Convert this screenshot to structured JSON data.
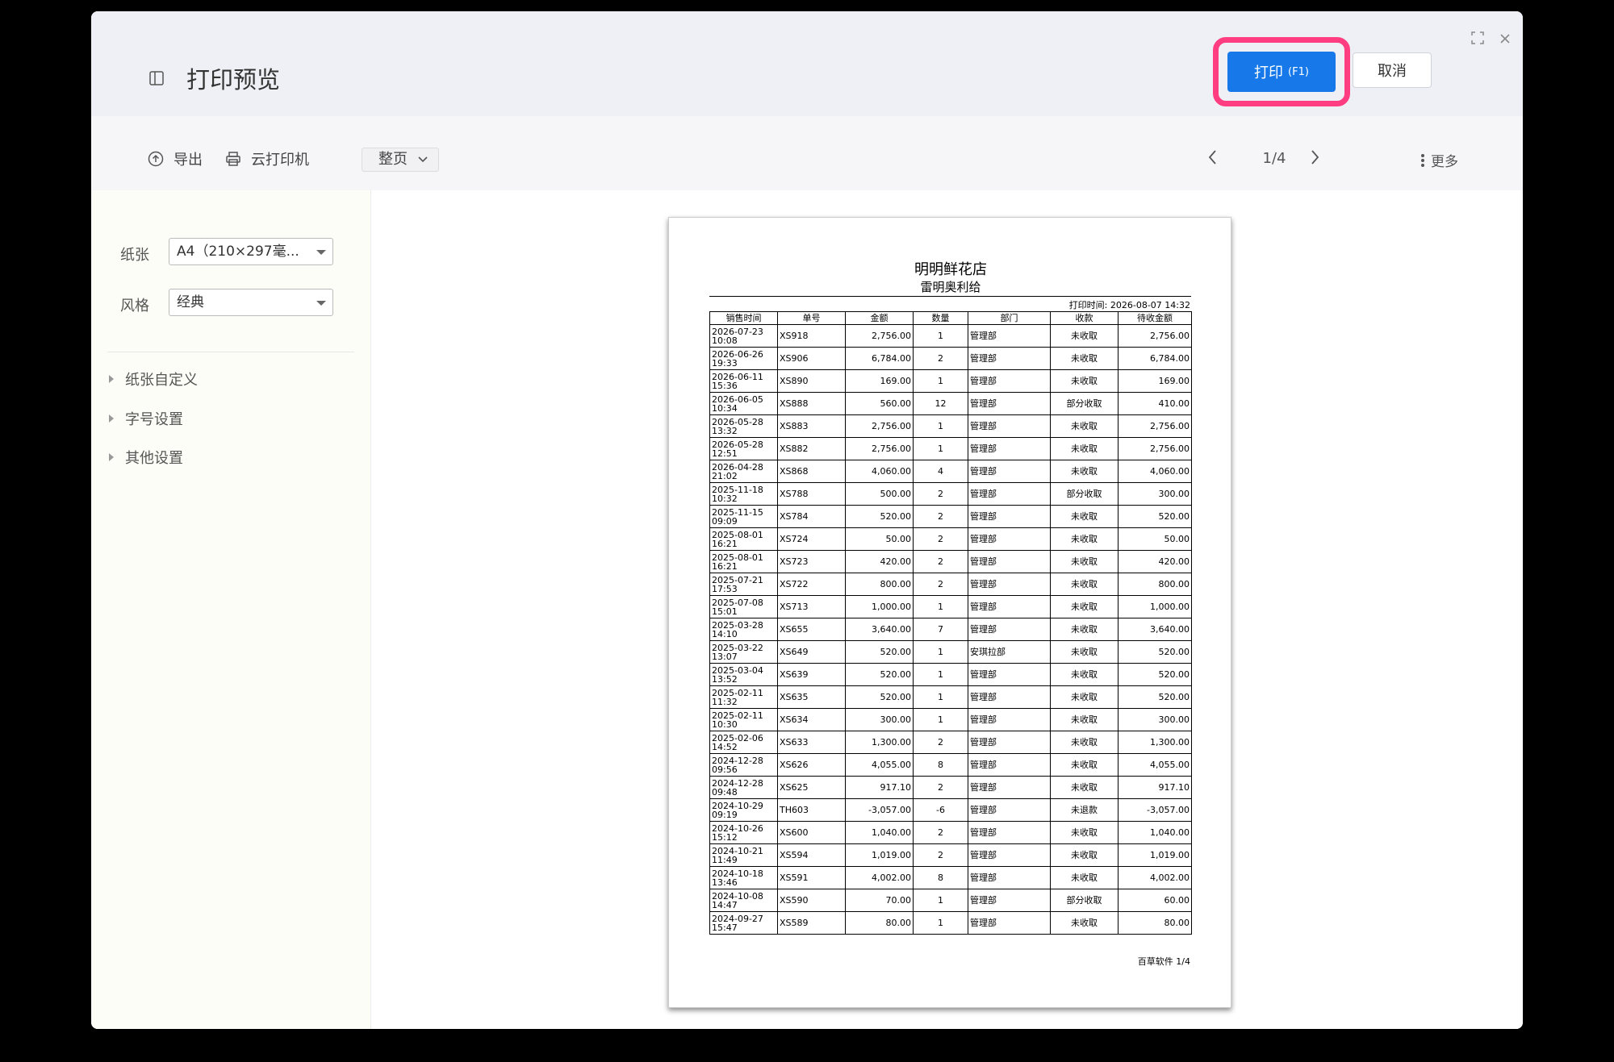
{
  "dialog": {
    "title": "打印预览",
    "print_label": "打印",
    "print_shortcut": "(F1)",
    "cancel_label": "取消",
    "colors": {
      "primary": "#1779e9",
      "highlight": "#ff3d80"
    }
  },
  "toolbar": {
    "export_label": "导出",
    "cloud_printer_label": "云打印机",
    "page_mode": "整页",
    "page_indicator": "1/4",
    "more_label": "更多"
  },
  "sidebar": {
    "paper_label": "纸张",
    "paper_value": "A4（210×297毫...",
    "style_label": "风格",
    "style_value": "经典",
    "sections": [
      "纸张自定义",
      "字号设置",
      "其他设置"
    ]
  },
  "document": {
    "title": "明明鲜花店",
    "subtitle": "雷明奥利给",
    "print_time": "打印时间:  2026-08-07 14:32",
    "footer": "百草软件  1/4",
    "columns": [
      "销售时间",
      "单号",
      "金额",
      "数量",
      "部门",
      "收款",
      "待收金额"
    ],
    "rows": [
      [
        "2026-07-23 10:08",
        "XS918",
        "2,756.00",
        "1",
        "管理部",
        "未收取",
        "2,756.00"
      ],
      [
        "2026-06-26 19:33",
        "XS906",
        "6,784.00",
        "2",
        "管理部",
        "未收取",
        "6,784.00"
      ],
      [
        "2026-06-11 15:36",
        "XS890",
        "169.00",
        "1",
        "管理部",
        "未收取",
        "169.00"
      ],
      [
        "2026-06-05 10:34",
        "XS888",
        "560.00",
        "12",
        "管理部",
        "部分收取",
        "410.00"
      ],
      [
        "2026-05-28 13:32",
        "XS883",
        "2,756.00",
        "1",
        "管理部",
        "未收取",
        "2,756.00"
      ],
      [
        "2026-05-28 12:51",
        "XS882",
        "2,756.00",
        "1",
        "管理部",
        "未收取",
        "2,756.00"
      ],
      [
        "2026-04-28 21:02",
        "XS868",
        "4,060.00",
        "4",
        "管理部",
        "未收取",
        "4,060.00"
      ],
      [
        "2025-11-18 10:32",
        "XS788",
        "500.00",
        "2",
        "管理部",
        "部分收取",
        "300.00"
      ],
      [
        "2025-11-15 09:09",
        "XS784",
        "520.00",
        "2",
        "管理部",
        "未收取",
        "520.00"
      ],
      [
        "2025-08-01 16:21",
        "XS724",
        "50.00",
        "2",
        "管理部",
        "未收取",
        "50.00"
      ],
      [
        "2025-08-01 16:21",
        "XS723",
        "420.00",
        "2",
        "管理部",
        "未收取",
        "420.00"
      ],
      [
        "2025-07-21 17:53",
        "XS722",
        "800.00",
        "2",
        "管理部",
        "未收取",
        "800.00"
      ],
      [
        "2025-07-08 15:01",
        "XS713",
        "1,000.00",
        "1",
        "管理部",
        "未收取",
        "1,000.00"
      ],
      [
        "2025-03-28 14:10",
        "XS655",
        "3,640.00",
        "7",
        "管理部",
        "未收取",
        "3,640.00"
      ],
      [
        "2025-03-22 13:07",
        "XS649",
        "520.00",
        "1",
        "安琪拉部",
        "未收取",
        "520.00"
      ],
      [
        "2025-03-04 13:52",
        "XS639",
        "520.00",
        "1",
        "管理部",
        "未收取",
        "520.00"
      ],
      [
        "2025-02-11 11:32",
        "XS635",
        "520.00",
        "1",
        "管理部",
        "未收取",
        "520.00"
      ],
      [
        "2025-02-11 10:30",
        "XS634",
        "300.00",
        "1",
        "管理部",
        "未收取",
        "300.00"
      ],
      [
        "2025-02-06 14:52",
        "XS633",
        "1,300.00",
        "2",
        "管理部",
        "未收取",
        "1,300.00"
      ],
      [
        "2024-12-28 09:56",
        "XS626",
        "4,055.00",
        "8",
        "管理部",
        "未收取",
        "4,055.00"
      ],
      [
        "2024-12-28 09:48",
        "XS625",
        "917.10",
        "2",
        "管理部",
        "未收取",
        "917.10"
      ],
      [
        "2024-10-29 09:19",
        "TH603",
        "-3,057.00",
        "-6",
        "管理部",
        "未退款",
        "-3,057.00"
      ],
      [
        "2024-10-26 15:12",
        "XS600",
        "1,040.00",
        "2",
        "管理部",
        "未收取",
        "1,040.00"
      ],
      [
        "2024-10-21 11:49",
        "XS594",
        "1,019.00",
        "2",
        "管理部",
        "未收取",
        "1,019.00"
      ],
      [
        "2024-10-18 13:46",
        "XS591",
        "4,002.00",
        "8",
        "管理部",
        "未收取",
        "4,002.00"
      ],
      [
        "2024-10-08 14:47",
        "XS590",
        "70.00",
        "1",
        "管理部",
        "部分收取",
        "60.00"
      ],
      [
        "2024-09-27 15:47",
        "XS589",
        "80.00",
        "1",
        "管理部",
        "未收取",
        "80.00"
      ]
    ]
  }
}
